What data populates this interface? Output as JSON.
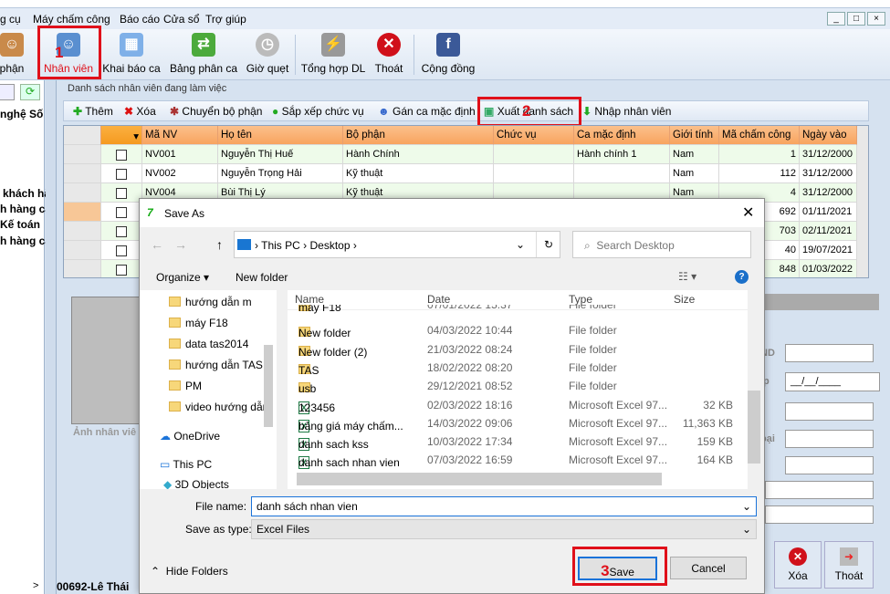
{
  "menu": [
    "g cụ",
    "Máy chấm công",
    "Báo cáo",
    "Cửa sổ",
    "Trợ giúp"
  ],
  "window_controls": [
    "_",
    "□",
    "×"
  ],
  "toolbar": [
    {
      "label": "phận",
      "icon": "departments-icon"
    },
    {
      "label": "Nhân viên",
      "icon": "employee-icon"
    },
    {
      "label": "Khai báo ca",
      "icon": "calendar-icon"
    },
    {
      "label": "Bảng phân ca",
      "icon": "swap-arrows-icon"
    },
    {
      "label": "Giờ quẹt",
      "icon": "clock-icon"
    },
    {
      "label": "Tổng hợp DL",
      "icon": "printer-lightning-icon"
    },
    {
      "label": "Thoát",
      "icon": "exit-x-icon"
    },
    {
      "label": "Cộng đồng",
      "icon": "facebook-icon"
    }
  ],
  "steps": [
    "1",
    "2",
    "3"
  ],
  "left_panel": {
    "items": [
      "nghệ Số A",
      "khách hà",
      "h hàng ca",
      "Kế toán",
      "h hàng ca"
    ],
    "scroll_right": ">"
  },
  "main": {
    "title": "Danh sách nhân viên đang làm việc",
    "grid_toolbar": [
      "Thêm",
      "Xóa",
      "Chuyển bộ phận",
      "Sắp xếp chức vụ",
      "Gán ca mặc định",
      "Xuất danh sách",
      "Nhập nhân viên"
    ],
    "columns": [
      "Mã NV",
      "Họ tên",
      "Bộ phận",
      "Chức vụ",
      "Ca mặc định",
      "Giới tính",
      "Mã chấm công",
      "Ngày vào"
    ],
    "rows": [
      [
        "NV001",
        "Nguyễn Thị Huế",
        "Hành Chính",
        "",
        "Hành chính 1",
        "Nam",
        "1",
        "31/12/2000"
      ],
      [
        "NV002",
        "Nguyễn Trọng Hải",
        "Kỹ thuật",
        "",
        "",
        "Nam",
        "112",
        "31/12/2000"
      ],
      [
        "NV004",
        "Bùi Thị Lý",
        "Kỹ thuật",
        "",
        "",
        "Nam",
        "4",
        "31/12/2000"
      ],
      [
        "",
        "",
        "",
        "",
        "",
        "",
        "692",
        "01/11/2021"
      ],
      [
        "",
        "",
        "",
        "",
        "",
        "",
        "703",
        "02/11/2021"
      ],
      [
        "",
        "",
        "",
        "",
        "",
        "",
        "40",
        "19/07/2021"
      ],
      [
        "",
        "",
        "",
        "",
        "",
        "",
        "848",
        "01/03/2022"
      ]
    ],
    "photo_label": "Ảnh nhân viê",
    "form_labels": [
      "ND",
      "ip",
      "",
      "oại"
    ],
    "date_mask": "__/__/____",
    "status": "00692-Lê Thái",
    "buttons": {
      "delete": "Xóa",
      "exit": "Thoát"
    }
  },
  "dialog": {
    "title": "Save As",
    "path": [
      "This PC",
      "Desktop"
    ],
    "search_placeholder": "Search Desktop",
    "organize": "Organize",
    "new_folder": "New folder",
    "nav": [
      "hướng dẫn m",
      "máy F18",
      "data tas2014",
      "hướng dẫn TAS t",
      "PM",
      "video hướng dẫn",
      "OneDrive",
      "This PC",
      "3D Objects"
    ],
    "headers": [
      "Name",
      "Date",
      "Type",
      "Size"
    ],
    "files": [
      {
        "name": "máy F18",
        "date": "07/01/2022 15:37",
        "type": "File folder",
        "size": "",
        "kind": "folder"
      },
      {
        "name": "New folder",
        "date": "04/03/2022 10:44",
        "type": "File folder",
        "size": "",
        "kind": "folder"
      },
      {
        "name": "New folder (2)",
        "date": "21/03/2022 08:24",
        "type": "File folder",
        "size": "",
        "kind": "folder"
      },
      {
        "name": "TAS",
        "date": "18/02/2022 08:20",
        "type": "File folder",
        "size": "",
        "kind": "folder"
      },
      {
        "name": "usb",
        "date": "29/12/2021 08:52",
        "type": "File folder",
        "size": "",
        "kind": "folder"
      },
      {
        "name": "123456",
        "date": "02/03/2022 18:16",
        "type": "Microsoft Excel 97...",
        "size": "32 KB",
        "kind": "excel"
      },
      {
        "name": "bảng giá máy chấm...",
        "date": "14/03/2022 09:06",
        "type": "Microsoft Excel 97...",
        "size": "11,363 KB",
        "kind": "excel"
      },
      {
        "name": "danh sach kss",
        "date": "10/03/2022 17:34",
        "type": "Microsoft Excel 97...",
        "size": "159 KB",
        "kind": "excel"
      },
      {
        "name": "danh sach nhan vien",
        "date": "07/03/2022 16:59",
        "type": "Microsoft Excel 97...",
        "size": "164 KB",
        "kind": "excel"
      }
    ],
    "file_name_label": "File name:",
    "file_name": "danh sách nhan vien",
    "type_label": "Save as type:",
    "type_value": "Excel Files",
    "hide_folders": "Hide Folders",
    "save": "Save",
    "cancel": "Cancel"
  }
}
